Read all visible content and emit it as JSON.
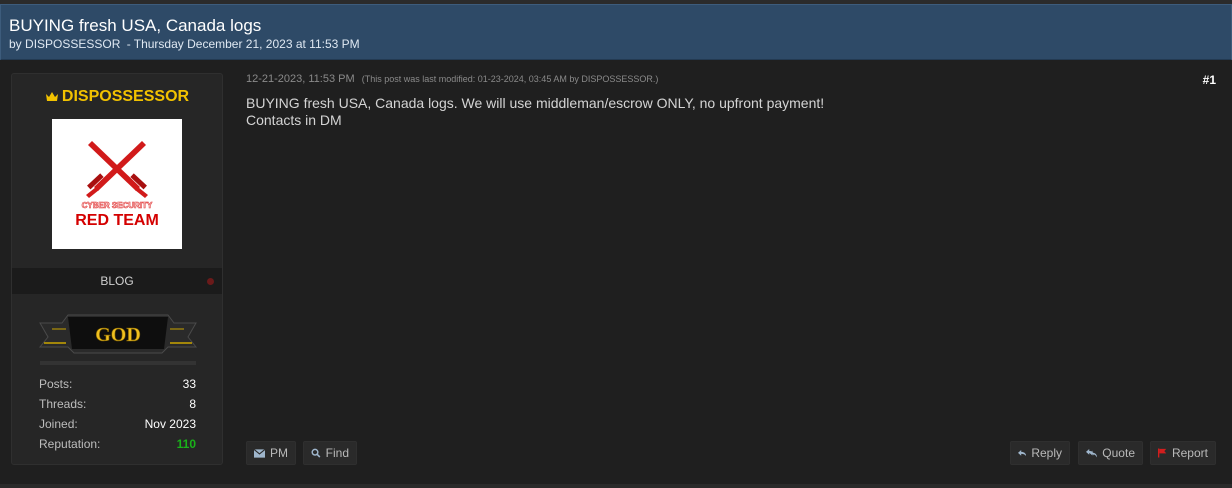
{
  "thread": {
    "title": "BUYING fresh USA, Canada logs",
    "by_label": "by",
    "author": "DISPOSSESSOR",
    "separator": "-",
    "date": "Thursday December 21, 2023 at 11:53 PM"
  },
  "author_panel": {
    "name": "DISPOSSESSOR",
    "avatar_lines": [
      "CYBER SECURITY",
      "RED TEAM"
    ],
    "usertitle": "BLOG",
    "rank_label": "GOD",
    "stats": [
      {
        "label": "Posts:",
        "value": "33"
      },
      {
        "label": "Threads:",
        "value": "8"
      },
      {
        "label": "Joined:",
        "value": "Nov 2023"
      },
      {
        "label": "Reputation:",
        "value": "110"
      }
    ]
  },
  "post": {
    "datetime": "12-21-2023, 11:53 PM",
    "modified_note": "(This post was last modified: 01-23-2024, 03:45 AM by DISPOSSESSOR.)",
    "number": "#1",
    "body_lines": [
      "BUYING fresh USA, Canada logs. We will use middleman/escrow ONLY, no upfront payment!",
      "Contacts in DM"
    ]
  },
  "buttons": {
    "pm": "PM",
    "find": "Find",
    "reply": "Reply",
    "quote": "Quote",
    "report": "Report"
  },
  "colors": {
    "header_bg": "#2e4a67",
    "username": "#f2c200",
    "reputation": "#19b219",
    "report_flag": "#d21e1e"
  },
  "icons": [
    "crown-icon",
    "envelope-icon",
    "search-icon",
    "reply-icon",
    "quote-icon",
    "flag-icon"
  ]
}
